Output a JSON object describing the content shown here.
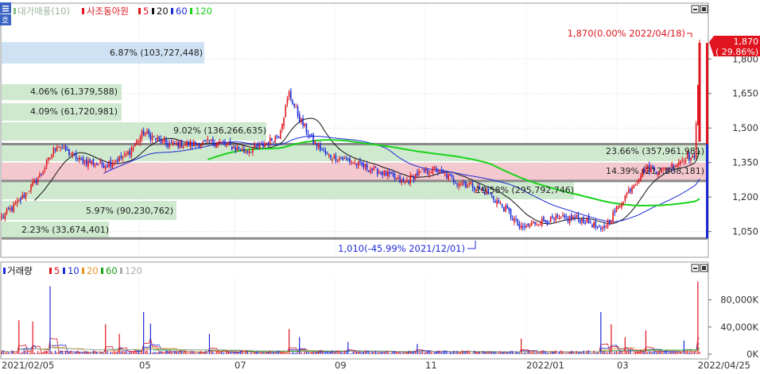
{
  "colors": {
    "up": "#e0141e",
    "down": "#1c2bd6",
    "ma5": "#e0141e",
    "ma10": "#1c2bd6",
    "ma20": "#111111",
    "ma60": "#1c2bd6",
    "ma120": "#18d318",
    "band_green": "#cfe9cf",
    "band_pink": "#f3c9cf",
    "band_blue": "#cfe2f3",
    "hline": "#8a8a8a",
    "grid": "#d8d8d8"
  },
  "icons": {
    "top_left": "menu-icon",
    "panel_buttons": [
      "minimize-icon",
      "maximize-icon"
    ]
  },
  "price_panel": {
    "legend": {
      "toggle": "호",
      "name": "대가매풍(10)",
      "stock": "사조동아원",
      "ma": [
        "5",
        "20",
        "60",
        "120"
      ]
    },
    "price_axis": [
      "1,800",
      "1,650",
      "1,500",
      "1,350",
      "1,200",
      "1,050"
    ],
    "high_annotation": "1,870(0.00% 2022/04/18)",
    "low_annotation": "1,010(-45.99% 2021/12/01)",
    "current_price": "1,870",
    "current_change": "( 29.86%)",
    "volume_profile": [
      {
        "text": "6.87% (103,727,448)"
      },
      {
        "text": "4.06% (61,379,588)"
      },
      {
        "text": "4.09% (61,720,981)"
      },
      {
        "text": "9.02% (136,266,635)"
      },
      {
        "text": "23.66% (357,961,981)"
      },
      {
        "text": "14.39% (217,808,181)"
      },
      {
        "text": "19.58% (295,792,746)"
      },
      {
        "text": "5.97% (90,230,762)"
      },
      {
        "text": "2.23% (33,674,401)"
      }
    ]
  },
  "volume_panel": {
    "legend": {
      "name": "거래량",
      "ma": [
        "5",
        "10",
        "20",
        "60",
        "120"
      ]
    },
    "axis": [
      "80,000K",
      "40,000K",
      "0K"
    ]
  },
  "x_axis": {
    "labels": [
      "2021/02/05",
      "05",
      "07",
      "09",
      "11",
      "2022/01",
      "03",
      "2022/04/25"
    ]
  },
  "chart_data": {
    "type": "candlestick",
    "period": {
      "start": "2021/02/05",
      "end": "2022/04/25"
    },
    "price_ylim": [
      950,
      1920
    ],
    "volume_ylim": [
      0,
      110000000
    ],
    "high": {
      "price": 1870,
      "change_pct": 0.0,
      "date": "2022/04/18"
    },
    "low": {
      "price": 1010,
      "change_pct": -45.99,
      "date": "2021/12/01"
    },
    "last": {
      "price": 1870,
      "change_pct": 29.86
    },
    "price_path": [
      [
        0,
        1110
      ],
      [
        10,
        1180
      ],
      [
        22,
        1290
      ],
      [
        32,
        1430
      ],
      [
        45,
        1360
      ],
      [
        60,
        1340
      ],
      [
        72,
        1380
      ],
      [
        82,
        1480
      ],
      [
        95,
        1430
      ],
      [
        110,
        1430
      ],
      [
        125,
        1440
      ],
      [
        140,
        1400
      ],
      [
        150,
        1420
      ],
      [
        160,
        1470
      ],
      [
        166,
        1650
      ],
      [
        172,
        1540
      ],
      [
        180,
        1440
      ],
      [
        188,
        1380
      ],
      [
        200,
        1360
      ],
      [
        210,
        1330
      ],
      [
        222,
        1300
      ],
      [
        232,
        1260
      ],
      [
        240,
        1300
      ],
      [
        250,
        1320
      ],
      [
        262,
        1270
      ],
      [
        272,
        1250
      ],
      [
        282,
        1210
      ],
      [
        292,
        1140
      ],
      [
        300,
        1060
      ],
      [
        308,
        1090
      ],
      [
        318,
        1100
      ],
      [
        330,
        1110
      ],
      [
        340,
        1090
      ],
      [
        346,
        1050
      ],
      [
        352,
        1110
      ],
      [
        358,
        1180
      ],
      [
        364,
        1250
      ],
      [
        372,
        1330
      ],
      [
        380,
        1310
      ],
      [
        388,
        1340
      ],
      [
        396,
        1380
      ],
      [
        400,
        1360
      ],
      [
        403,
        1870
      ]
    ],
    "price_bands": [
      {
        "label": "6.87% (103,727,448)",
        "price_from": 1770,
        "price_to": 1850,
        "pct": 6.87,
        "volume": 103727448
      },
      {
        "label": "4.06% (61,379,588)",
        "price_from": 1625,
        "price_to": 1690,
        "pct": 4.06,
        "volume": 61379588
      },
      {
        "label": "4.09% (61,720,981)",
        "price_from": 1545,
        "price_to": 1610,
        "pct": 4.09,
        "volume": 61720981
      },
      {
        "label": "9.02% (136,266,635)",
        "price_from": 1450,
        "price_to": 1530,
        "pct": 9.02,
        "volume": 136266635
      },
      {
        "label": "23.66% (357,961,981)",
        "price_from": 1340,
        "price_to": 1430,
        "pct": 23.66,
        "volume": 357961981
      },
      {
        "label": "14.39% (217,808,181)",
        "price_from": 1270,
        "price_to": 1340,
        "pct": 14.39,
        "volume": 217808181
      },
      {
        "label": "19.58% (295,792,746)",
        "price_from": 1180,
        "price_to": 1270,
        "pct": 19.58,
        "volume": 295792746
      },
      {
        "label": "5.97% (90,230,762)",
        "price_from": 1080,
        "price_to": 1165,
        "pct": 5.97,
        "volume": 90230762
      },
      {
        "label": "2.23% (33,674,401)",
        "price_from": 1015,
        "price_to": 1075,
        "pct": 2.23,
        "volume": 33674401
      }
    ],
    "reference_lines": [
      1430,
      1270,
      1020
    ],
    "volume_spikes": [
      [
        10,
        50000000
      ],
      [
        18,
        48000000
      ],
      [
        28,
        100000000
      ],
      [
        60,
        44000000
      ],
      [
        68,
        30000000
      ],
      [
        82,
        62000000
      ],
      [
        86,
        45000000
      ],
      [
        120,
        30000000
      ],
      [
        166,
        37000000
      ],
      [
        172,
        25000000
      ],
      [
        200,
        18000000
      ],
      [
        240,
        15000000
      ],
      [
        300,
        23000000
      ],
      [
        346,
        62000000
      ],
      [
        352,
        44000000
      ],
      [
        360,
        25000000
      ],
      [
        372,
        35000000
      ],
      [
        394,
        20000000
      ],
      [
        402,
        107000000
      ]
    ]
  }
}
